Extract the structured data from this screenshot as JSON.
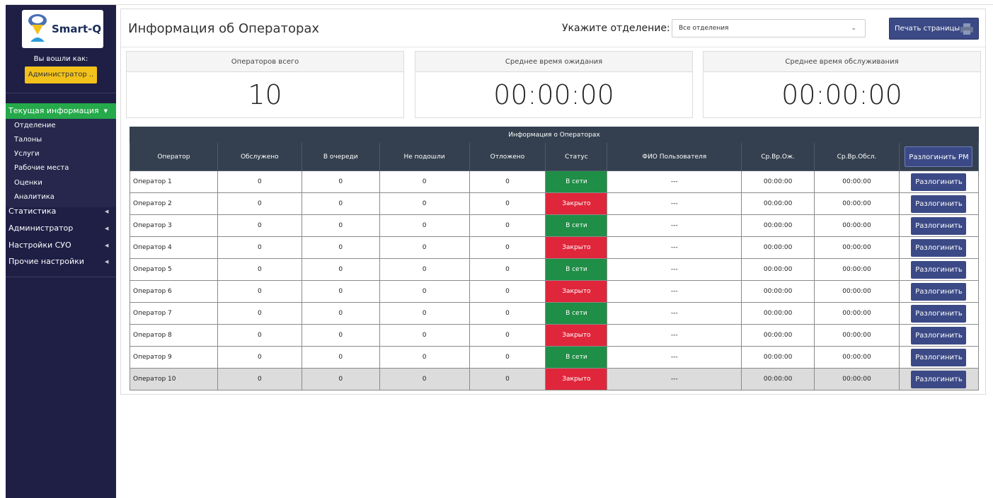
{
  "app": {
    "logo_text": "Smart-Q"
  },
  "sidebar": {
    "login_label": "Вы вошли как:",
    "user_name": "Администратор ..",
    "active_menu": "Текущая информация",
    "submenu": [
      "Отделение",
      "Талоны",
      "Услуги",
      "Рабочие места",
      "Оценки",
      "Аналитика"
    ],
    "menu": [
      "Статистика",
      "Администратор",
      "Настройки СУО",
      "Прочие настройки"
    ]
  },
  "header": {
    "title": "Информация об Операторах",
    "branch_label": "Укажите отделение:",
    "branch_value": "Все отделения",
    "print_label": "Печать страницы"
  },
  "stats": [
    {
      "label": "Операторов всего",
      "value": "10"
    },
    {
      "label": "Среднее время ожидания",
      "value": "00:00:00"
    },
    {
      "label": "Среднее время обслуживания",
      "value": "00:00:00"
    }
  ],
  "table": {
    "caption": "Информация о Операторах",
    "columns": [
      "Оператор",
      "Обслужено",
      "В очереди",
      "Не подошли",
      "Отложено",
      "Статус",
      "ФИО Пользователя",
      "Ср.Вр.Ож.",
      "Ср.Вр.Обсл."
    ],
    "logout_all_label": "Разлогинить РМ",
    "logout_label": "Разлогинить",
    "rows": [
      {
        "operator": "Оператор 1",
        "served": "0",
        "queue": "0",
        "noshow": "0",
        "postponed": "0",
        "status": "В сети",
        "online": true,
        "user": "---",
        "wait": "00:00:00",
        "service": "00:00:00"
      },
      {
        "operator": "Оператор 2",
        "served": "0",
        "queue": "0",
        "noshow": "0",
        "postponed": "0",
        "status": "Закрыто",
        "online": false,
        "user": "---",
        "wait": "00:00:00",
        "service": "00:00:00"
      },
      {
        "operator": "Оператор 3",
        "served": "0",
        "queue": "0",
        "noshow": "0",
        "postponed": "0",
        "status": "В сети",
        "online": true,
        "user": "---",
        "wait": "00:00:00",
        "service": "00:00:00"
      },
      {
        "operator": "Оператор 4",
        "served": "0",
        "queue": "0",
        "noshow": "0",
        "postponed": "0",
        "status": "Закрыто",
        "online": false,
        "user": "---",
        "wait": "00:00:00",
        "service": "00:00:00"
      },
      {
        "operator": "Оператор 5",
        "served": "0",
        "queue": "0",
        "noshow": "0",
        "postponed": "0",
        "status": "В сети",
        "online": true,
        "user": "---",
        "wait": "00:00:00",
        "service": "00:00:00"
      },
      {
        "operator": "Оператор 6",
        "served": "0",
        "queue": "0",
        "noshow": "0",
        "postponed": "0",
        "status": "Закрыто",
        "online": false,
        "user": "---",
        "wait": "00:00:00",
        "service": "00:00:00"
      },
      {
        "operator": "Оператор 7",
        "served": "0",
        "queue": "0",
        "noshow": "0",
        "postponed": "0",
        "status": "В сети",
        "online": true,
        "user": "---",
        "wait": "00:00:00",
        "service": "00:00:00"
      },
      {
        "operator": "Оператор 8",
        "served": "0",
        "queue": "0",
        "noshow": "0",
        "postponed": "0",
        "status": "Закрыто",
        "online": false,
        "user": "---",
        "wait": "00:00:00",
        "service": "00:00:00"
      },
      {
        "operator": "Оператор 9",
        "served": "0",
        "queue": "0",
        "noshow": "0",
        "postponed": "0",
        "status": "В сети",
        "online": true,
        "user": "---",
        "wait": "00:00:00",
        "service": "00:00:00"
      },
      {
        "operator": "Оператор 10",
        "served": "0",
        "queue": "0",
        "noshow": "0",
        "postponed": "0",
        "status": "Закрыто",
        "online": false,
        "user": "---",
        "wait": "00:00:00",
        "service": "00:00:00"
      }
    ]
  },
  "colors": {
    "sidebar_bg": "#1f1e45",
    "active": "#25a94a",
    "online": "#1f8e46",
    "closed": "#e0263b",
    "button": "#3b4a86",
    "user_badge": "#f2c21b"
  }
}
